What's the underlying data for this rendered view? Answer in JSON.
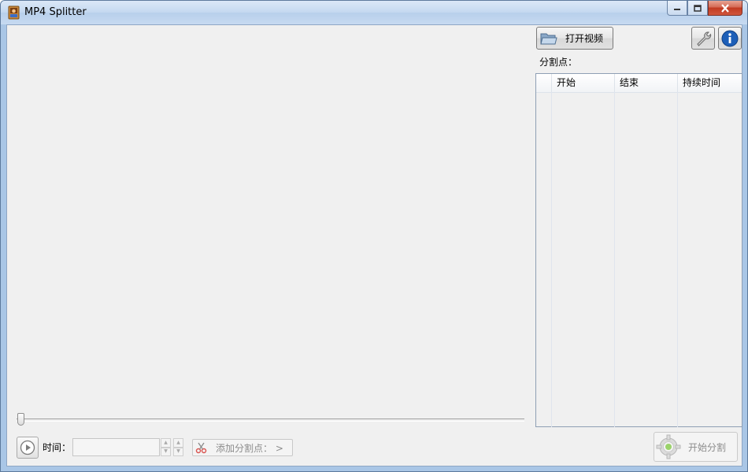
{
  "window": {
    "title": "MP4 Splitter"
  },
  "toolbar": {
    "open_video_label": "打开视频",
    "settings_icon": "wrench-icon",
    "info_icon": "info-icon"
  },
  "split_points": {
    "label": "分割点：",
    "columns": [
      "开始",
      "结束",
      "持续时间"
    ],
    "rows": []
  },
  "playback": {
    "time_label": "时间：",
    "time_value": "",
    "add_split_label": "添加分割点： >"
  },
  "actions": {
    "start_split_label": "开始分割"
  }
}
